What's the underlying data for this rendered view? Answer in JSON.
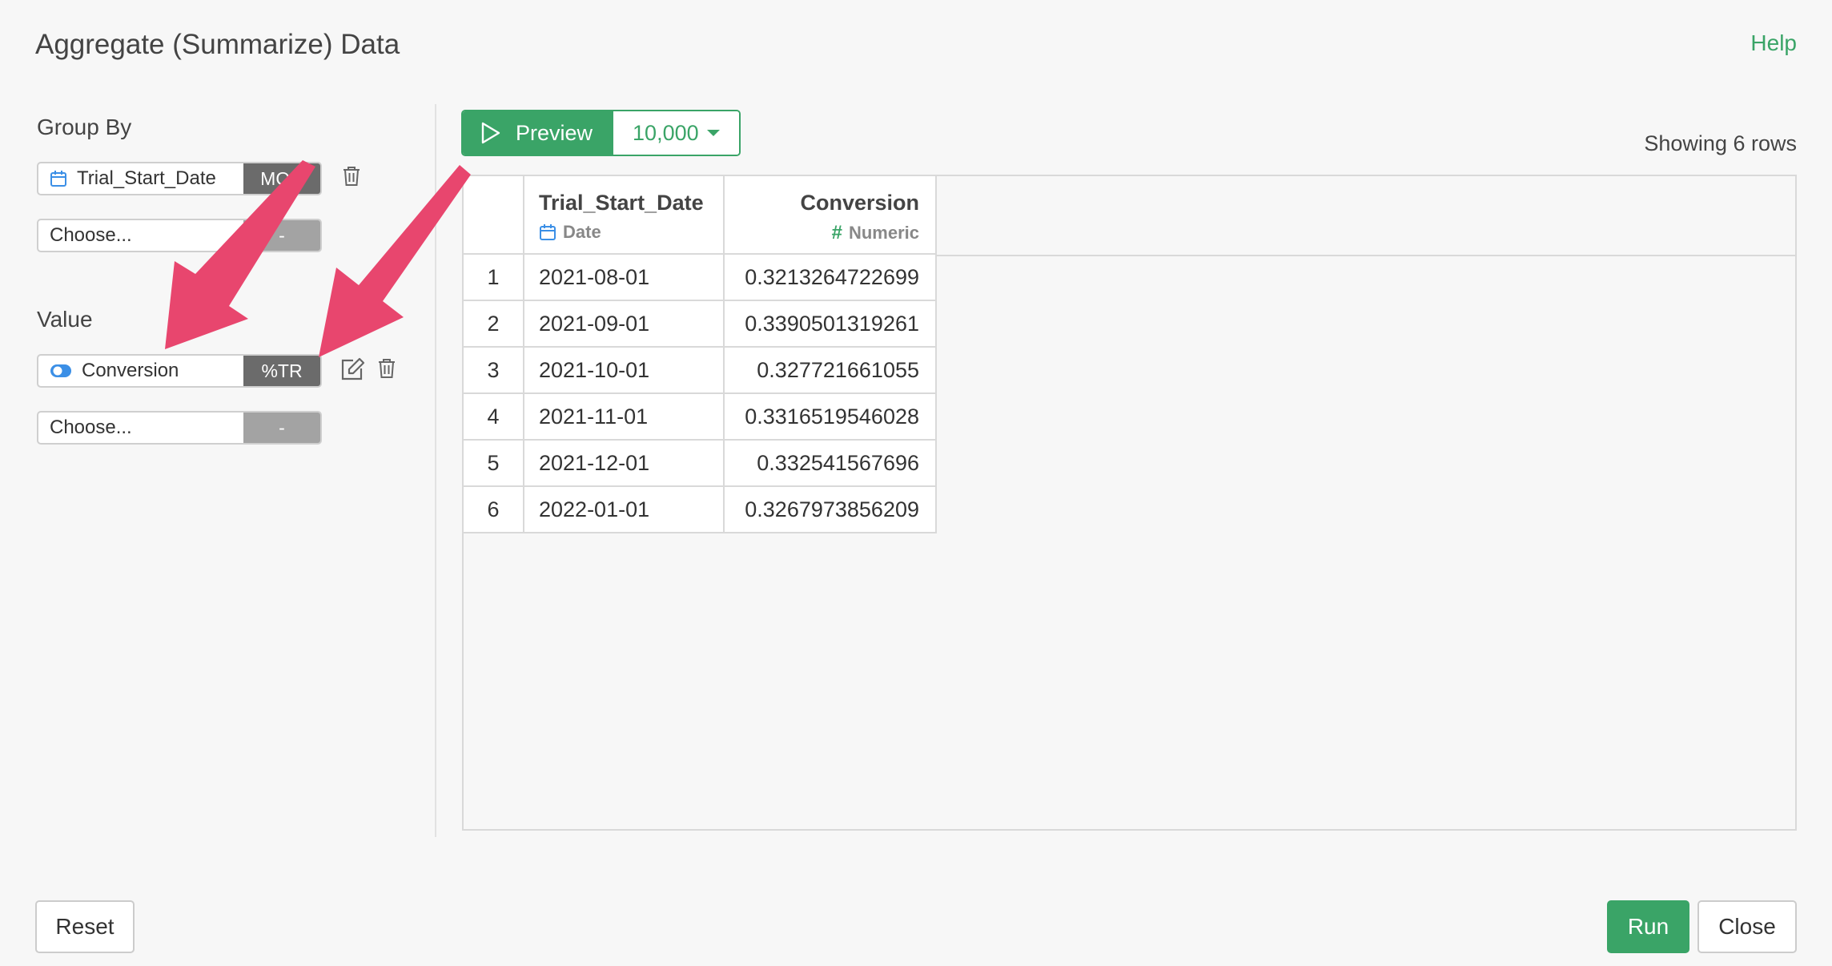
{
  "dialog": {
    "title": "Aggregate (Summarize) Data",
    "help_label": "Help"
  },
  "group_by": {
    "label": "Group By",
    "fields": [
      {
        "name": "Trial_Start_Date",
        "tag": "MON",
        "icon": "calendar-icon"
      },
      {
        "name": "Choose...",
        "tag": "-"
      }
    ]
  },
  "value": {
    "label": "Value",
    "fields": [
      {
        "name": "Conversion",
        "tag": "%TR",
        "icon": "toggle-icon"
      },
      {
        "name": "Choose...",
        "tag": "-"
      }
    ]
  },
  "preview": {
    "button_label": "Preview",
    "rows_option": "10,000",
    "showing_text": "Showing 6 rows"
  },
  "table": {
    "columns": [
      {
        "name": "Trial_Start_Date",
        "type": "Date",
        "icon": "calendar-icon"
      },
      {
        "name": "Conversion",
        "type": "Numeric",
        "icon": "hash-icon"
      }
    ],
    "rows": [
      {
        "n": "1",
        "date": "2021-08-01",
        "conv": "0.3213264722699"
      },
      {
        "n": "2",
        "date": "2021-09-01",
        "conv": "0.3390501319261"
      },
      {
        "n": "3",
        "date": "2021-10-01",
        "conv": "0.327721661055"
      },
      {
        "n": "4",
        "date": "2021-11-01",
        "conv": "0.3316519546028"
      },
      {
        "n": "5",
        "date": "2021-12-01",
        "conv": "0.332541567696"
      },
      {
        "n": "6",
        "date": "2022-01-01",
        "conv": "0.3267973856209"
      }
    ]
  },
  "footer": {
    "reset_label": "Reset",
    "run_label": "Run",
    "close_label": "Close"
  },
  "colors": {
    "accent": "#3aa467",
    "annotation_arrow": "#e8466e",
    "calendar_icon": "#3b8fe6"
  }
}
